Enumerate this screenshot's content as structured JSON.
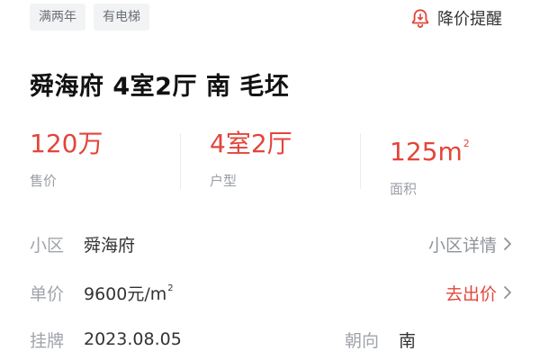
{
  "tags": [
    "满两年",
    "有电梯"
  ],
  "price_alert": {
    "label": "降价提醒",
    "icon": "bell-alert-icon"
  },
  "title": "舜海府 4室2厅 南 毛坯",
  "stats": [
    {
      "value": "120万",
      "label": "售价"
    },
    {
      "value": "4室2厅",
      "label": "户型"
    },
    {
      "value": "125m",
      "sup": "2",
      "label": "面积"
    }
  ],
  "details": {
    "community": {
      "label": "小区",
      "value": "舜海府",
      "link": "小区详情"
    },
    "unit_price": {
      "label": "单价",
      "value": "9600元/m",
      "sup": "2",
      "link": "去出价"
    },
    "listing": {
      "label": "挂牌",
      "value": "2023.08.05"
    },
    "orientation": {
      "label": "朝向",
      "value": "南"
    }
  },
  "colors": {
    "accent": "#e3453a",
    "muted": "#a0a4ab",
    "tag_bg": "#f2f3f5"
  }
}
